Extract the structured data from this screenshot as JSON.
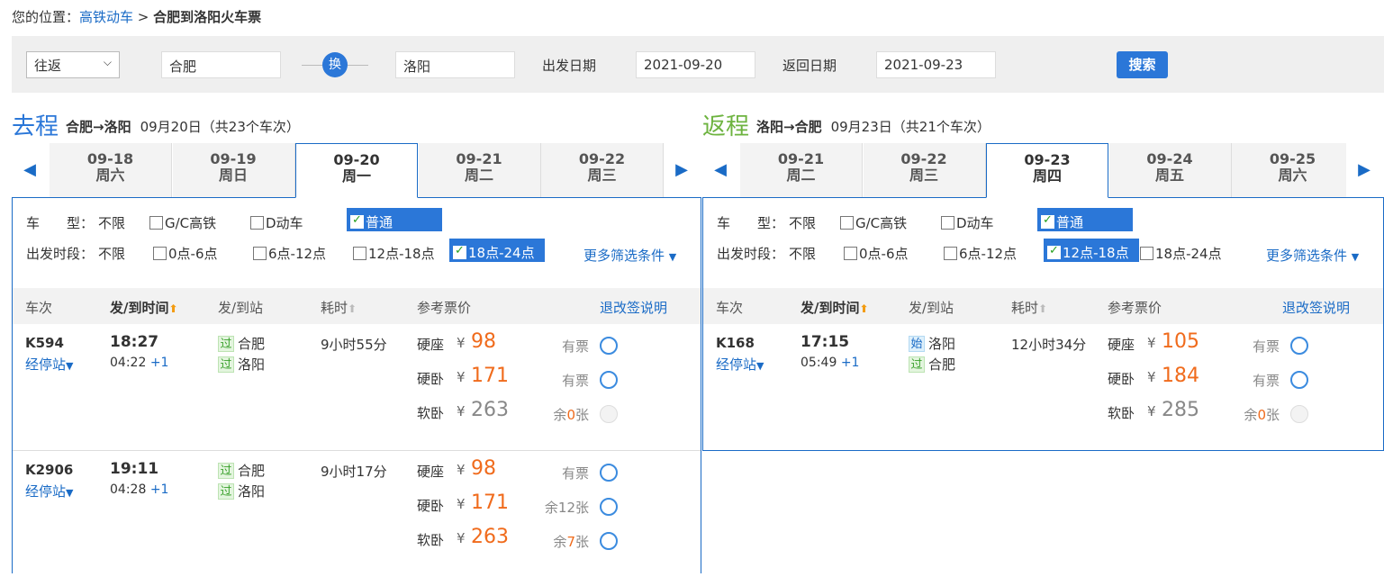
{
  "breadcrumb": {
    "prefix": "您的位置：",
    "link": "高铁动车",
    "sep": " > ",
    "current": "合肥到洛阳火车票"
  },
  "search": {
    "trip_type": "往返",
    "from": "合肥",
    "swap": "换",
    "to": "洛阳",
    "depart_label": "出发日期",
    "depart_date": "2021-09-20",
    "return_label": "返回日期",
    "return_date": "2021-09-23",
    "button": "搜索"
  },
  "outbound": {
    "title": "去程",
    "route": "合肥→洛阳",
    "date": "09月20日",
    "count": "（共23个车次）",
    "dates": [
      {
        "d": "09-18",
        "w": "周六"
      },
      {
        "d": "09-19",
        "w": "周日"
      },
      {
        "d": "09-20",
        "w": "周一"
      },
      {
        "d": "09-21",
        "w": "周二"
      },
      {
        "d": "09-22",
        "w": "周三"
      }
    ],
    "filter_type_label": "车　　型：",
    "filter_type_all": "不限",
    "filter_type": [
      "G/C高铁",
      "D动车",
      "普通"
    ],
    "filter_time_label": "出发时段：",
    "filter_time_all": "不限",
    "filter_time": [
      "0点-6点",
      "6点-12点",
      "12点-18点",
      "18点-24点"
    ],
    "more": "更多筛选条件",
    "trains": [
      {
        "no": "K594",
        "stops": "经停站",
        "dep": "18:27",
        "arr": "04:22",
        "plus": "+1",
        "from_tag": "过",
        "from": "合肥",
        "to_tag": "过",
        "to": "洛阳",
        "dur": "9小时55分",
        "seats": [
          {
            "name": "硬座",
            "price": "98",
            "avail": "有票"
          },
          {
            "name": "硬卧",
            "price": "171",
            "avail": "有票"
          },
          {
            "name": "软卧",
            "price": "263",
            "avail_pre": "余",
            "avail_num": "0",
            "avail_post": "张"
          }
        ]
      },
      {
        "no": "K2906",
        "stops": "经停站",
        "dep": "19:11",
        "arr": "04:28",
        "plus": "+1",
        "from_tag": "过",
        "from": "合肥",
        "to_tag": "过",
        "to": "洛阳",
        "dur": "9小时17分",
        "seats": [
          {
            "name": "硬座",
            "price": "98",
            "avail": "有票"
          },
          {
            "name": "硬卧",
            "price": "171",
            "avail": "余12张"
          },
          {
            "name": "软卧",
            "price": "263",
            "avail_pre": "余",
            "avail_num": "7",
            "avail_post": "张"
          }
        ]
      }
    ]
  },
  "return": {
    "title": "返程",
    "route": "洛阳→合肥",
    "date": "09月23日",
    "count": "（共21个车次）",
    "dates": [
      {
        "d": "09-21",
        "w": "周二"
      },
      {
        "d": "09-22",
        "w": "周三"
      },
      {
        "d": "09-23",
        "w": "周四"
      },
      {
        "d": "09-24",
        "w": "周五"
      },
      {
        "d": "09-25",
        "w": "周六"
      }
    ],
    "filter_type_label": "车　　型：",
    "filter_type_all": "不限",
    "filter_type": [
      "G/C高铁",
      "D动车",
      "普通"
    ],
    "filter_time_label": "出发时段：",
    "filter_time_all": "不限",
    "filter_time": [
      "0点-6点",
      "6点-12点",
      "12点-18点",
      "18点-24点"
    ],
    "more": "更多筛选条件",
    "trains": [
      {
        "no": "K168",
        "stops": "经停站",
        "dep": "17:15",
        "arr": "05:49",
        "plus": "+1",
        "from_tag": "始",
        "from": "洛阳",
        "to_tag": "过",
        "to": "合肥",
        "dur": "12小时34分",
        "seats": [
          {
            "name": "硬座",
            "price": "105",
            "avail": "有票"
          },
          {
            "name": "硬卧",
            "price": "184",
            "avail": "有票"
          },
          {
            "name": "软卧",
            "price": "285",
            "avail_pre": "余",
            "avail_num": "0",
            "avail_post": "张"
          }
        ]
      }
    ]
  },
  "table_head": {
    "no": "车次",
    "time": "发/到时间",
    "station": "发/到站",
    "dur": "耗时",
    "price": "参考票价",
    "refund": "退改签说明"
  },
  "symbols": {
    "yen": "¥",
    "up_arrow": "⬆",
    "left": "◀",
    "right": "▶",
    "down": "▼"
  },
  "colors": {
    "accent": "#2b77d8",
    "price": "#f06b1c",
    "return_title": "#6db33f"
  }
}
